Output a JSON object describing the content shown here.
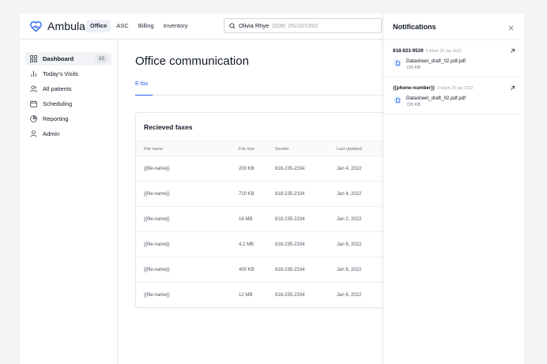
{
  "app": {
    "name": "Ambula"
  },
  "nav": [
    {
      "label": "Office",
      "active": true
    },
    {
      "label": "ASC",
      "active": false
    },
    {
      "label": "Billing",
      "active": false
    },
    {
      "label": "Inventory",
      "active": false
    }
  ],
  "search": {
    "patient_name": "Olivia Rhye",
    "dob": "DOB: 05/20/1992"
  },
  "sidebar": {
    "items": [
      {
        "label": "Dashboard",
        "icon": "grid-icon",
        "badge": "10",
        "active": true
      },
      {
        "label": "Today's Visits",
        "icon": "bar-chart-icon"
      },
      {
        "label": "All patients",
        "icon": "users-icon"
      },
      {
        "label": "Scheduling",
        "icon": "calendar-icon"
      },
      {
        "label": "Reporting",
        "icon": "pie-chart-icon"
      },
      {
        "label": "Admin",
        "icon": "user-icon"
      }
    ]
  },
  "main": {
    "title": "Office communication",
    "tabs": [
      {
        "label": "E-fax",
        "active": true
      }
    ],
    "card": {
      "title": "Recieved faxes",
      "columns": [
        "File name",
        "File size",
        "Sender",
        "Last updated"
      ],
      "rows": [
        {
          "file_name": "{{file-name}}",
          "size": "200 KB",
          "sender": "818-235-2334",
          "updated": "Jan 4, 2022"
        },
        {
          "file_name": "{{file-name}}",
          "size": "720 KB",
          "sender": "818-235-2334",
          "updated": "Jan 4, 2022"
        },
        {
          "file_name": "{{file-name}}",
          "size": "16 MB",
          "sender": "818-235-2334",
          "updated": "Jan 2, 2022"
        },
        {
          "file_name": "{{file-name}}",
          "size": "4.2 MB",
          "sender": "818-235-2334",
          "updated": "Jan 6, 2022"
        },
        {
          "file_name": "{{file-name}}",
          "size": "400 KB",
          "sender": "818-235-2334",
          "updated": "Jan 8, 2022"
        },
        {
          "file_name": "{{file-name}}",
          "size": "12 MB",
          "sender": "818-235-2334",
          "updated": "Jan 6, 2022"
        }
      ]
    }
  },
  "notifications": {
    "title": "Notifications",
    "items": [
      {
        "sender": "818-823-9539",
        "time": "3:42pm 20 Jan 2022",
        "file_name": "Datasheet_draft_02.pdf.pdf",
        "file_size": "720 KB"
      },
      {
        "sender": "{{phone-number}}",
        "time": "3:42pm 20 Jan 2022",
        "file_name": "Datasheet_draft_02.pdf.pdf",
        "file_size": "720 KB"
      }
    ]
  },
  "colors": {
    "accent": "#2563eb",
    "border": "#e5e7eb",
    "file_icon_bg": "#dbeafe"
  }
}
